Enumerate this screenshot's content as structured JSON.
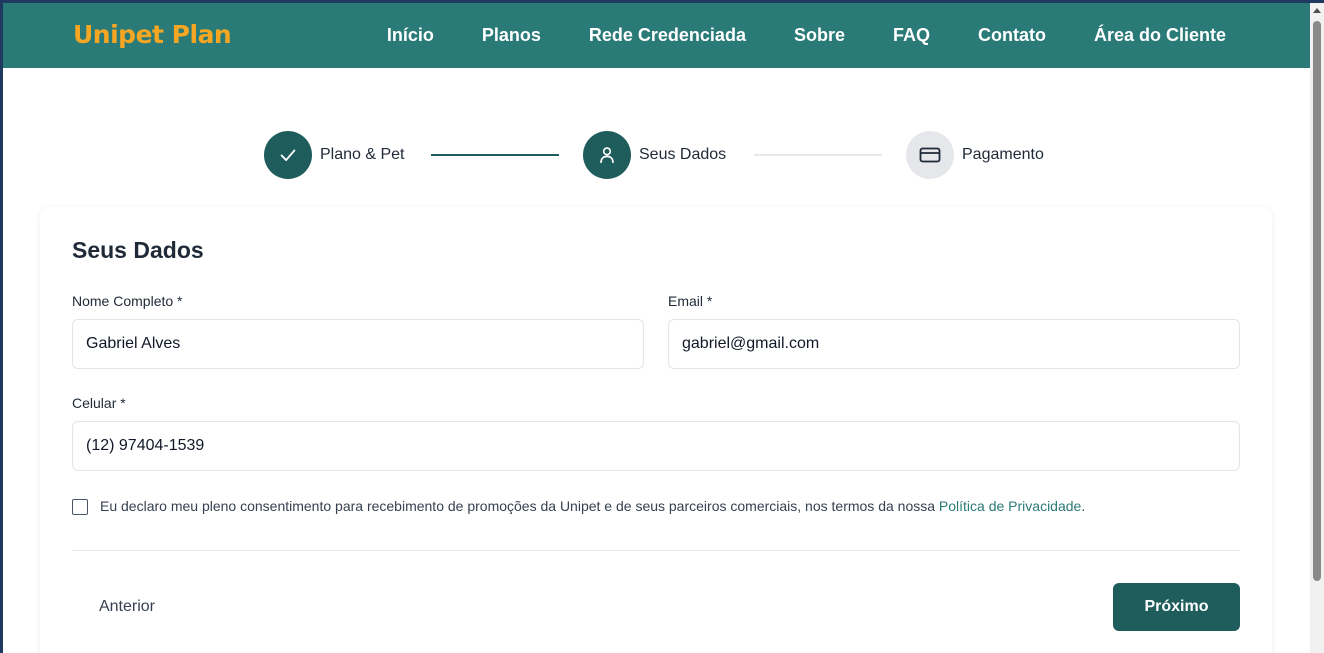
{
  "header": {
    "logo": "Unipet Plan",
    "nav": [
      "Início",
      "Planos",
      "Rede Credenciada",
      "Sobre",
      "FAQ",
      "Contato",
      "Área do Cliente"
    ]
  },
  "stepper": {
    "steps": [
      {
        "label": "Plano & Pet",
        "state": "done",
        "icon": "check-icon"
      },
      {
        "label": "Seus Dados",
        "state": "active",
        "icon": "user-icon"
      },
      {
        "label": "Pagamento",
        "state": "pending",
        "icon": "credit-card-icon"
      }
    ]
  },
  "form": {
    "title": "Seus Dados",
    "name": {
      "label": "Nome Completo *",
      "value": "Gabriel Alves"
    },
    "email": {
      "label": "Email *",
      "value": "gabriel@gmail.com"
    },
    "phone": {
      "label": "Celular *",
      "value": "(12) 97404-1539"
    },
    "consent": {
      "text": "Eu declaro meu pleno consentimento para recebimento de promoções da Unipet e de seus parceiros comerciais, nos termos da nossa ",
      "link": "Política de Privacidade",
      "suffix": ".",
      "checked": false
    },
    "prev_label": "Anterior",
    "next_label": "Próximo"
  },
  "colors": {
    "header_bg": "#2a7a78",
    "logo": "#f5a623",
    "primary": "#1f5c5c",
    "link": "#2a7a78",
    "pending": "#e5e7eb"
  }
}
